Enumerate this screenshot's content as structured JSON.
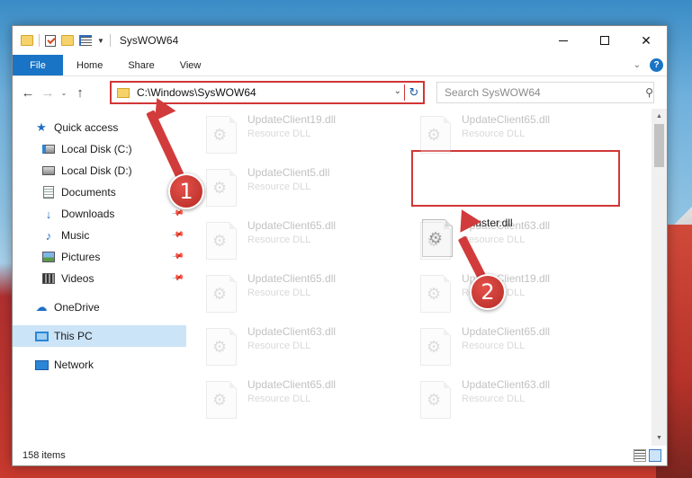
{
  "window": {
    "title": "SysWOW64",
    "controls": {
      "minimize": "—",
      "maximize": "☐",
      "close": "✕"
    }
  },
  "ribbon": {
    "tabs": [
      {
        "label": "File"
      },
      {
        "label": "Home"
      },
      {
        "label": "Share"
      },
      {
        "label": "View"
      }
    ],
    "help": "?",
    "collapse": "⌄"
  },
  "nav": {
    "back": "←",
    "forward": "→",
    "recent": "⌄",
    "up": "↑",
    "address": "C:\\Windows\\SysWOW64",
    "address_dropdown": "⌄",
    "refresh": "↻",
    "search_placeholder": "Search SysWOW64",
    "search_glyph": "⚲"
  },
  "sidebar": {
    "items": [
      {
        "label": "Quick access",
        "icon": "star-icon"
      },
      {
        "label": "Local Disk (C:)",
        "icon": "drive-icon"
      },
      {
        "label": "Local Disk (D:)",
        "icon": "drive-icon"
      },
      {
        "label": "Documents",
        "icon": "documents-icon"
      },
      {
        "label": "Downloads",
        "icon": "download-icon"
      },
      {
        "label": "Music",
        "icon": "music-icon"
      },
      {
        "label": "Pictures",
        "icon": "pictures-icon"
      },
      {
        "label": "Videos",
        "icon": "videos-icon"
      },
      {
        "label": "OneDrive",
        "icon": "cloud-icon"
      },
      {
        "label": "This PC",
        "icon": "computer-icon"
      },
      {
        "label": "Network",
        "icon": "network-icon"
      }
    ]
  },
  "files": [
    {
      "name": "UpdateClient19.dll",
      "type": "Resource DLL"
    },
    {
      "name": "UpdateClient65.dll",
      "type": "Resource DLL"
    },
    {
      "name": "UpdateClient5.dll",
      "type": "Resource DLL"
    },
    {
      "name": "Plluster.dll",
      "type": ""
    },
    {
      "name": "UpdateClient65.dll",
      "type": "Resource DLL"
    },
    {
      "name": "UpdateClient63.dll",
      "type": "Resource DLL"
    },
    {
      "name": "UpdateClient65.dll",
      "type": "Resource DLL"
    },
    {
      "name": "UpdateClient19.dll",
      "type": "Resource DLL"
    },
    {
      "name": "UpdateClient63.dll",
      "type": "Resource DLL"
    },
    {
      "name": "UpdateClient65.dll",
      "type": "Resource DLL"
    },
    {
      "name": "UpdateClient65.dll",
      "type": "Resource DLL"
    },
    {
      "name": "UpdateClient63.dll",
      "type": "Resource DLL"
    }
  ],
  "status": {
    "count": "158 items"
  },
  "callouts": [
    {
      "label": "1"
    },
    {
      "label": "2"
    }
  ],
  "colors": {
    "accent": "#1a74c6",
    "callout": "#d23b3b",
    "selected": "#cce4f7"
  }
}
